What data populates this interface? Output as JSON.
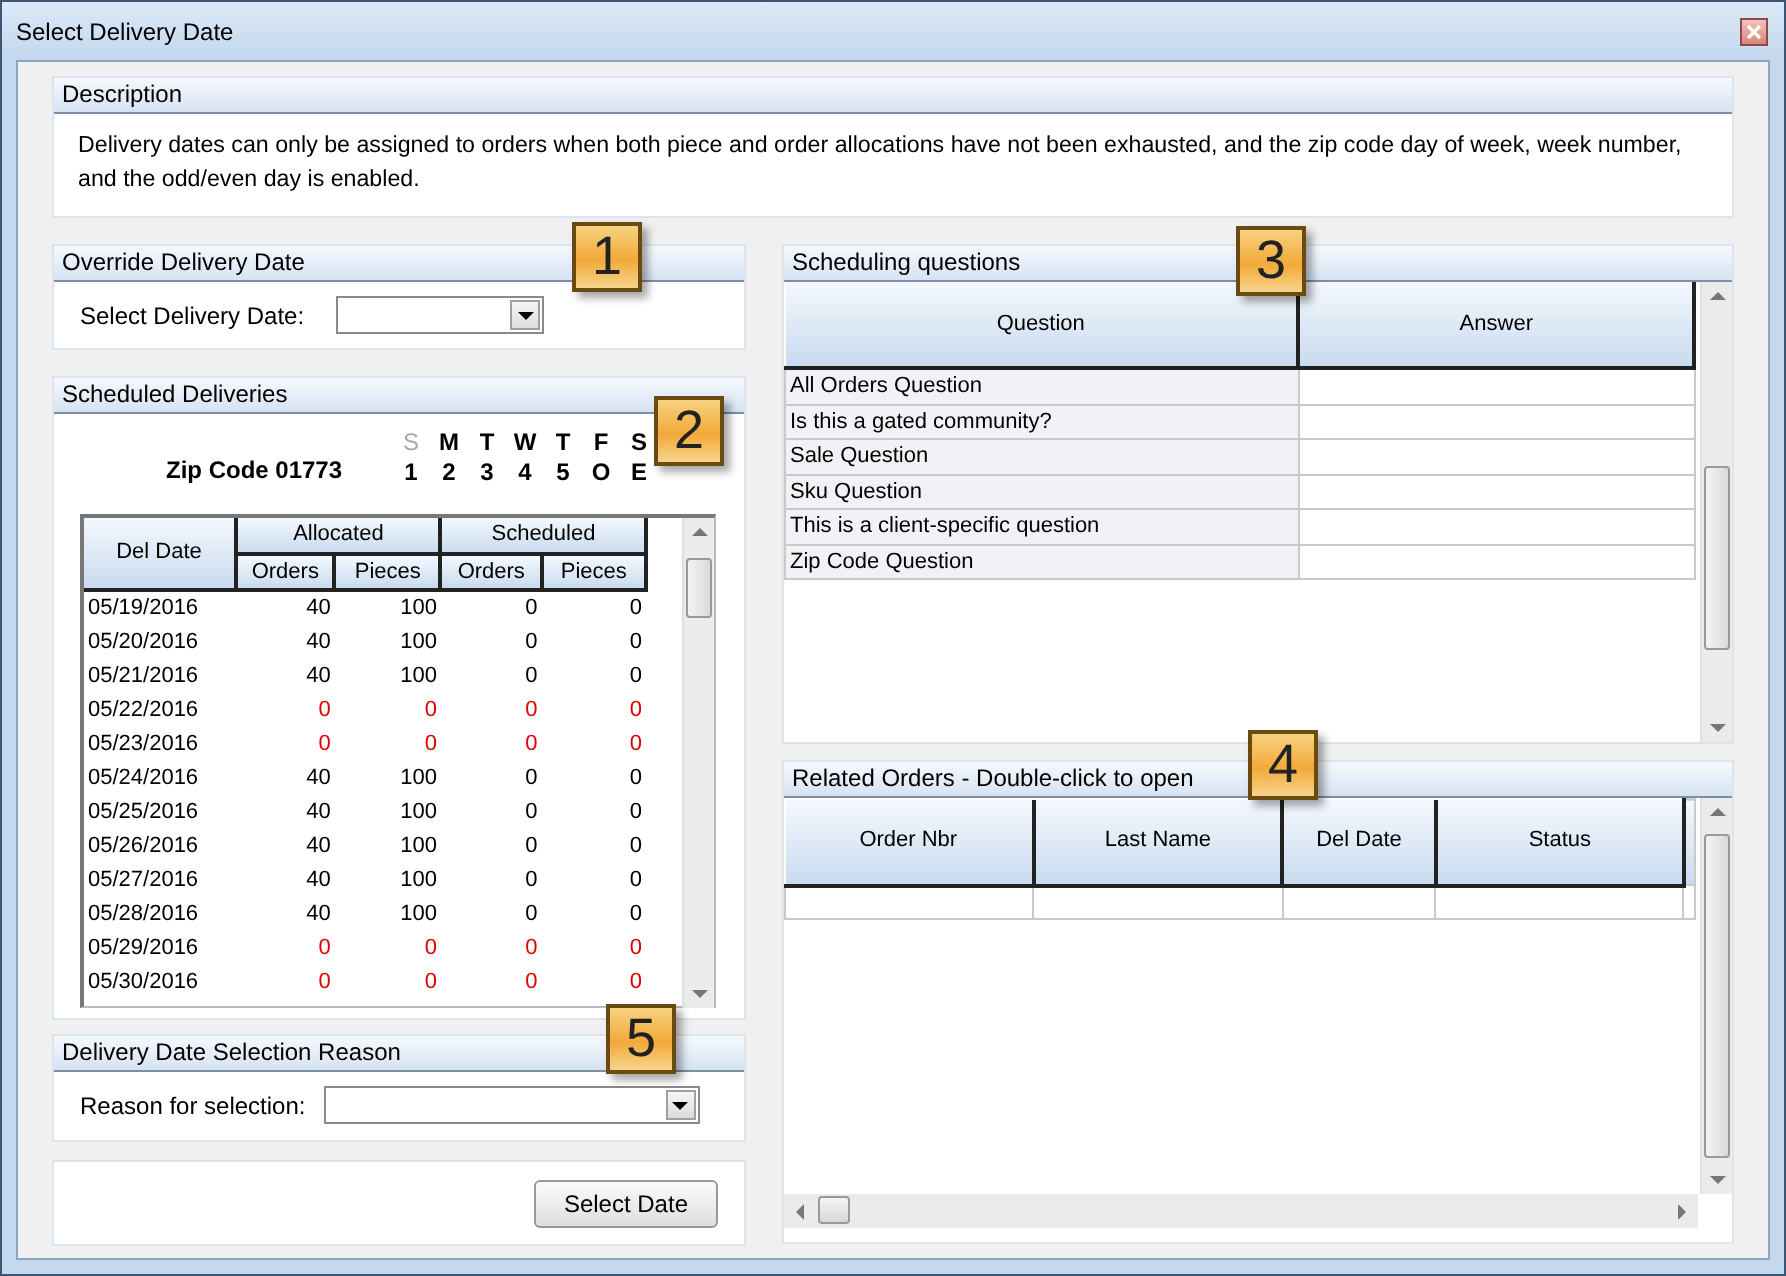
{
  "window": {
    "title": "Select Delivery Date"
  },
  "description": {
    "title": "Description",
    "text": "Delivery dates can only be assigned to orders when both piece and order allocations have not been exhausted, and the zip code day of week, week number, and the odd/even day is enabled."
  },
  "override": {
    "title": "Override Delivery Date",
    "callout": "1",
    "label": "Select Delivery Date:"
  },
  "scheduled": {
    "title": "Scheduled Deliveries",
    "callout": "2",
    "zip": "Zip Code 01773",
    "days": [
      {
        "letter": "S",
        "number": "1",
        "enabled": false
      },
      {
        "letter": "M",
        "number": "2",
        "enabled": true
      },
      {
        "letter": "T",
        "number": "3",
        "enabled": true
      },
      {
        "letter": "W",
        "number": "4",
        "enabled": true
      },
      {
        "letter": "T",
        "number": "5",
        "enabled": true
      },
      {
        "letter": "F",
        "number": "O",
        "enabled": true
      },
      {
        "letter": "S",
        "number": "E",
        "enabled": true
      }
    ],
    "columns": {
      "del_date": "Del Date",
      "allocated": "Allocated",
      "scheduled": "Scheduled",
      "sub": [
        "Orders",
        "Pieces",
        "Orders",
        "Pieces"
      ]
    },
    "rows": [
      {
        "date": "05/19/2016",
        "values": [
          "40",
          "100",
          "0",
          "0"
        ],
        "available": true
      },
      {
        "date": "05/20/2016",
        "values": [
          "40",
          "100",
          "0",
          "0"
        ],
        "available": true
      },
      {
        "date": "05/21/2016",
        "values": [
          "40",
          "100",
          "0",
          "0"
        ],
        "available": true
      },
      {
        "date": "05/22/2016",
        "values": [
          "0",
          "0",
          "0",
          "0"
        ],
        "available": false
      },
      {
        "date": "05/23/2016",
        "values": [
          "0",
          "0",
          "0",
          "0"
        ],
        "available": false
      },
      {
        "date": "05/24/2016",
        "values": [
          "40",
          "100",
          "0",
          "0"
        ],
        "available": true
      },
      {
        "date": "05/25/2016",
        "values": [
          "40",
          "100",
          "0",
          "0"
        ],
        "available": true
      },
      {
        "date": "05/26/2016",
        "values": [
          "40",
          "100",
          "0",
          "0"
        ],
        "available": true
      },
      {
        "date": "05/27/2016",
        "values": [
          "40",
          "100",
          "0",
          "0"
        ],
        "available": true
      },
      {
        "date": "05/28/2016",
        "values": [
          "40",
          "100",
          "0",
          "0"
        ],
        "available": true
      },
      {
        "date": "05/29/2016",
        "values": [
          "0",
          "0",
          "0",
          "0"
        ],
        "available": false
      },
      {
        "date": "05/30/2016",
        "values": [
          "0",
          "0",
          "0",
          "0"
        ],
        "available": false
      }
    ]
  },
  "reason": {
    "title": "Delivery Date Selection Reason",
    "callout": "5",
    "label": "Reason for selection:"
  },
  "select_button": "Select Date",
  "questions": {
    "title": "Scheduling questions",
    "callout": "3",
    "columns": [
      "Question",
      "Answer"
    ],
    "rows": [
      "All Orders Question",
      "Is this a gated community?",
      "Sale Question",
      "Sku Question",
      "This is a client-specific question",
      "Zip Code Question"
    ]
  },
  "related": {
    "title": "Related Orders - Double-click to open",
    "callout": "4",
    "columns": [
      "Order Nbr",
      "Last Name",
      "Del Date",
      "Status"
    ]
  }
}
